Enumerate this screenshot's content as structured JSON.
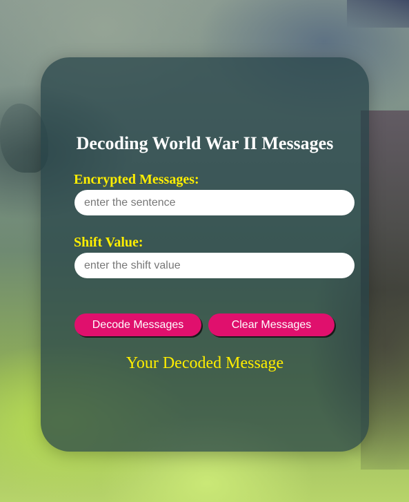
{
  "app": {
    "title": "Decoding World War II Messages"
  },
  "form": {
    "message_label": "Encrypted Messages:",
    "message_placeholder": "enter the sentence",
    "message_value": "",
    "shift_label": "Shift Value:",
    "shift_placeholder": "enter the shift value",
    "shift_value": ""
  },
  "buttons": {
    "decode_label": "Decode Messages",
    "clear_label": "Clear Messages"
  },
  "output": {
    "result_text": "Your Decoded Message"
  },
  "colors": {
    "accent_yellow": "#ffee00",
    "button_pink": "#e0106d",
    "card_background": "#264248"
  }
}
